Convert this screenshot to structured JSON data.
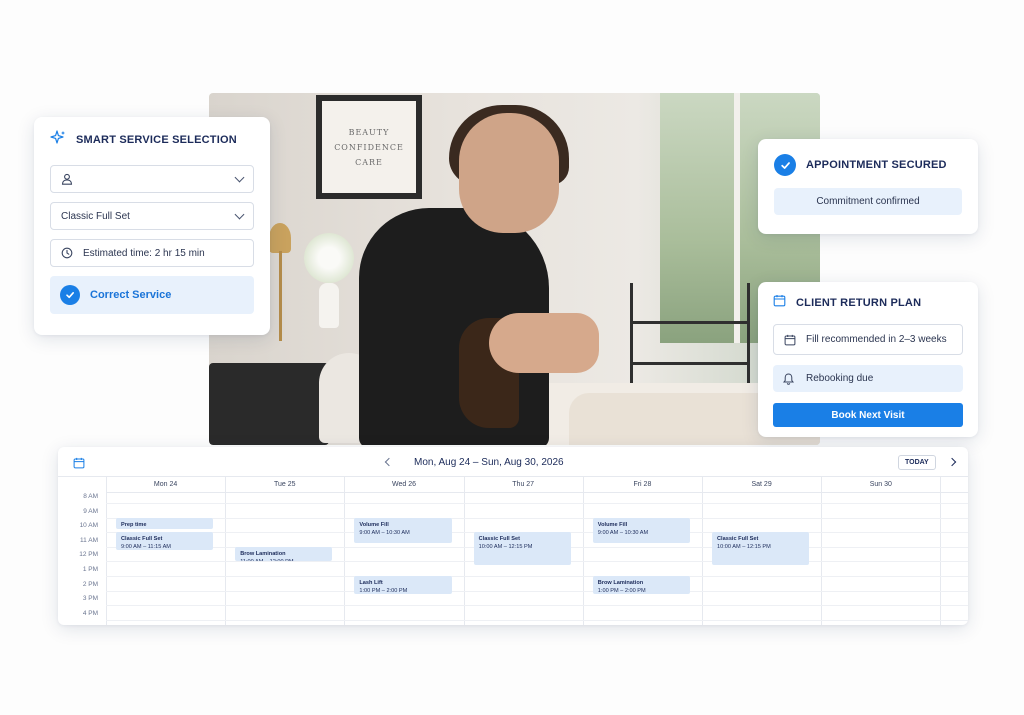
{
  "photo": {
    "poster_lines": [
      "BEAUTY",
      "CONFIDENCE",
      "CARE"
    ]
  },
  "smart_card": {
    "title": "SMART SERVICE SELECTION",
    "client_field_value": "",
    "service_value": "Classic Full Set",
    "estimated_time": "Estimated time: 2 hr 15 min",
    "status_label": "Correct Service"
  },
  "appointment_card": {
    "title": "APPOINTMENT SECURED",
    "status": "Commitment confirmed"
  },
  "return_plan": {
    "title": "CLIENT RETURN PLAN",
    "fill_text": "Fill recommended in 2–3 weeks",
    "rebook_text": "Rebooking due",
    "button_label": "Book Next Visit"
  },
  "calendar": {
    "range": "Mon, Aug 24 – Sun, Aug 30, 2026",
    "today_label": "TODAY",
    "days": [
      "Mon 24",
      "Tue 25",
      "Wed 26",
      "Thu 27",
      "Fri 28",
      "Sat 29",
      "Sun 30"
    ],
    "times": [
      "8 AM",
      "9 AM",
      "10 AM",
      "11 AM",
      "12 PM",
      "1 PM",
      "2 PM",
      "3 PM",
      "4 PM"
    ],
    "events": [
      {
        "day": 0,
        "start": 9.0,
        "end": 9.75,
        "title": "Prep time",
        "time": ""
      },
      {
        "day": 0,
        "start": 10.0,
        "end": 11.25,
        "title": "Classic Full Set",
        "time": "9:00 AM – 11:15 AM"
      },
      {
        "day": 1,
        "start": 11.0,
        "end": 12.0,
        "title": "Brow Lamination",
        "time": "11:00 AM – 12:00 PM"
      },
      {
        "day": 2,
        "start": 9.0,
        "end": 10.75,
        "title": "Volume Fill",
        "time": "9:00 AM – 10:30 AM"
      },
      {
        "day": 2,
        "start": 13.0,
        "end": 14.25,
        "title": "Lash Lift",
        "time": "1:00 PM – 2:00 PM"
      },
      {
        "day": 3,
        "start": 10.0,
        "end": 12.25,
        "title": "Classic Full Set",
        "time": "10:00 AM – 12:15 PM"
      },
      {
        "day": 4,
        "start": 9.0,
        "end": 10.75,
        "title": "Volume Fill",
        "time": "9:00 AM – 10:30 AM"
      },
      {
        "day": 4,
        "start": 13.0,
        "end": 14.25,
        "title": "Brow Lamination",
        "time": "1:00 PM – 2:00 PM"
      },
      {
        "day": 5,
        "start": 10.0,
        "end": 12.25,
        "title": "Classic Full Set",
        "time": "10:00 AM – 12:15 PM"
      }
    ]
  },
  "colors": {
    "accent": "#1a7fe6",
    "event_bg": "#dbe8f8",
    "heading": "#1c2b5a"
  }
}
